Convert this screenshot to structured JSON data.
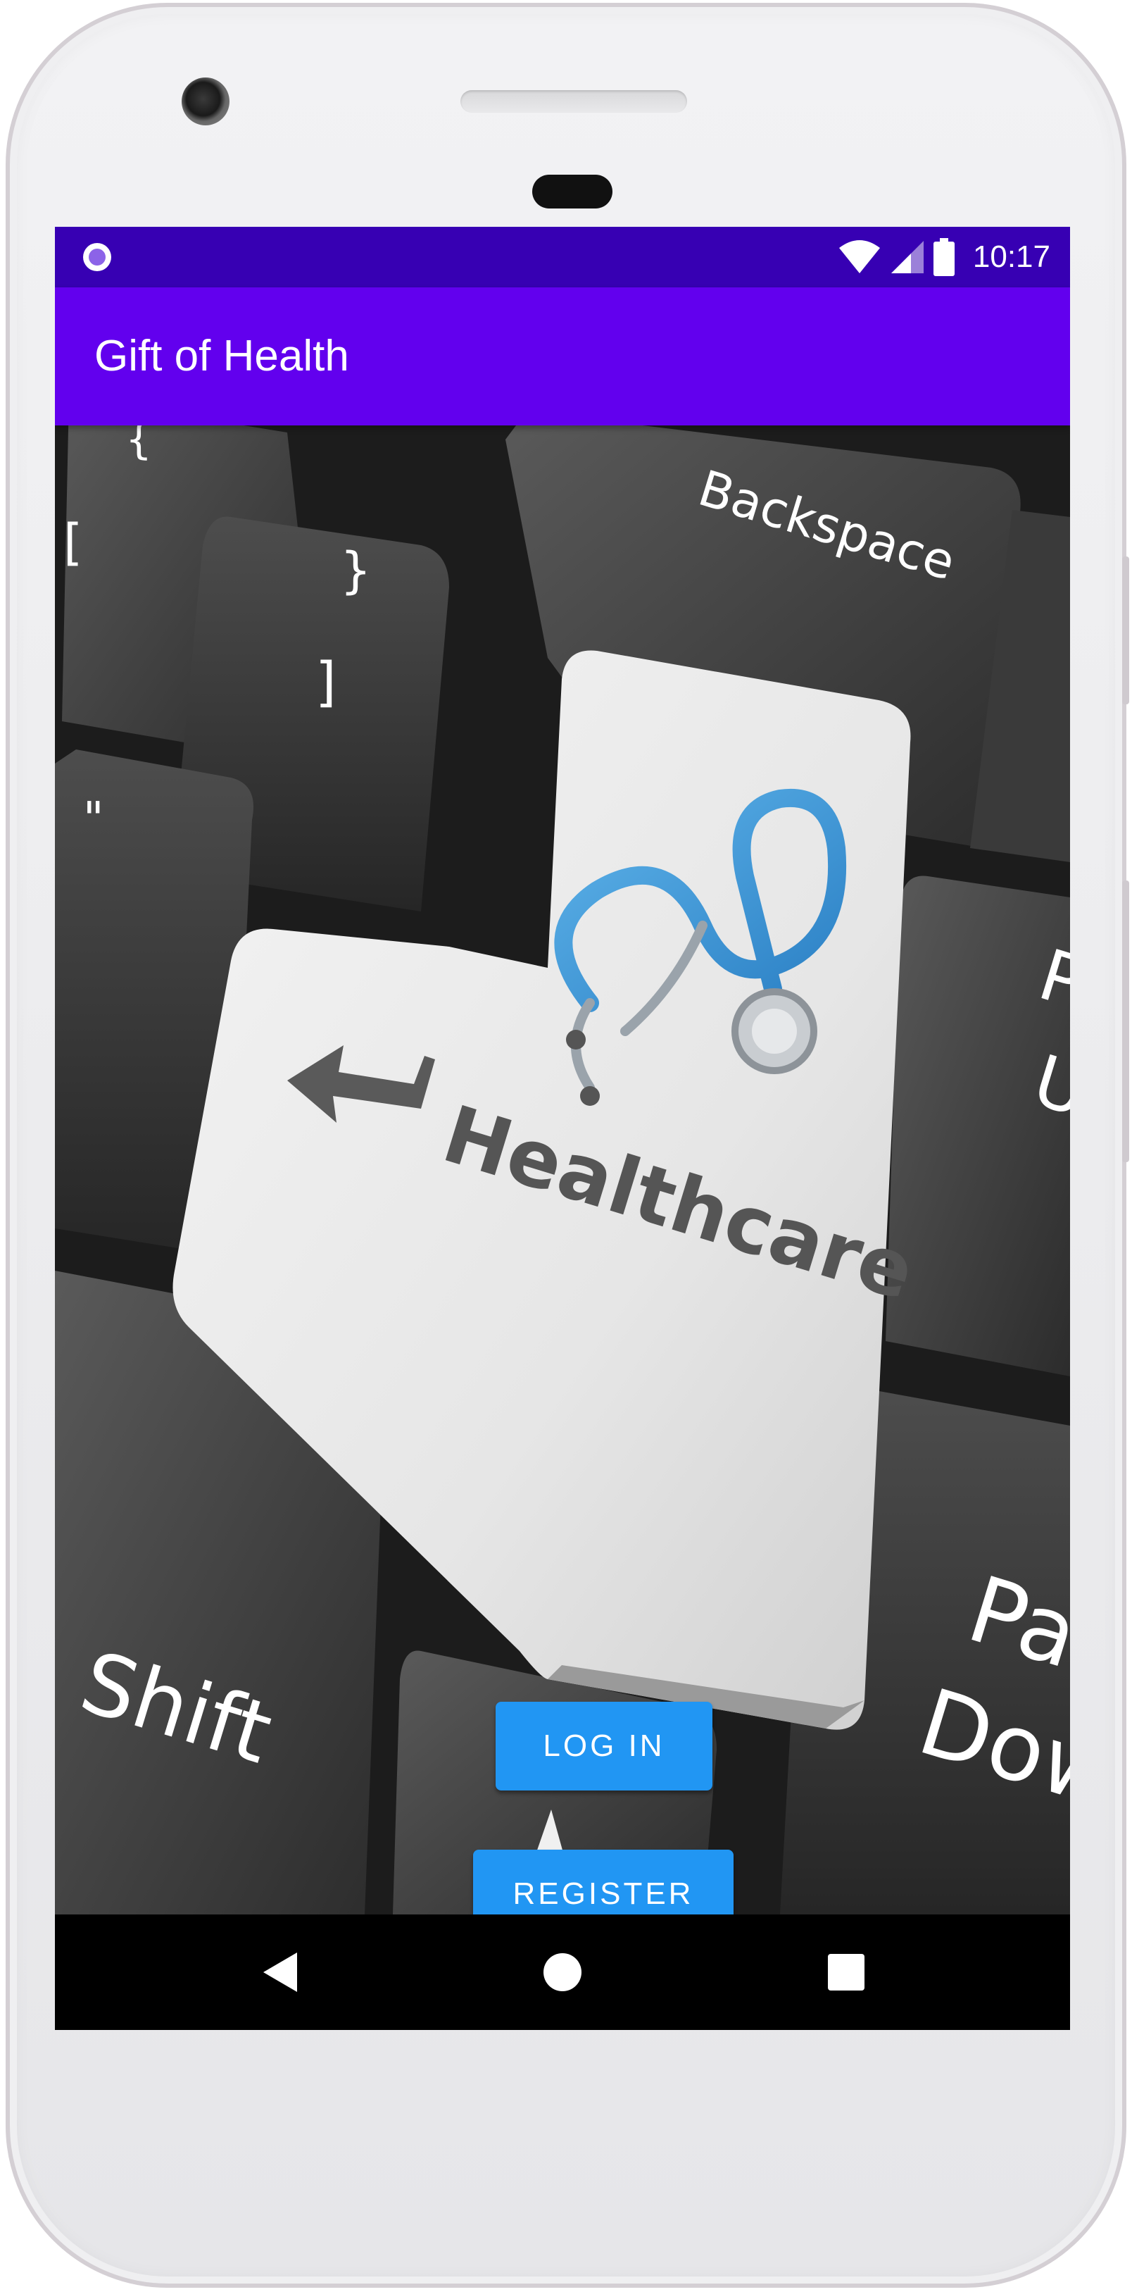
{
  "status_bar": {
    "time": "10:17",
    "background": "#3700b3",
    "icons": [
      "notification-dot-icon",
      "wifi-icon",
      "cellular-signal-icon",
      "battery-icon"
    ]
  },
  "app_bar": {
    "title": "Gift of Health",
    "background": "#6200ee"
  },
  "hero": {
    "key_labels": {
      "backspace": "Backspace",
      "healthcare": "Healthcare",
      "shift": "Shift",
      "page_down_1": "Pag",
      "page_down_2": "Dow",
      "brace_open": "{",
      "bracket_open": "[",
      "brace_close": "}",
      "bracket_close": "]",
      "quote": "\"",
      "page_up_1": "P",
      "page_up_2": "U"
    },
    "icons": [
      "stethoscope-icon",
      "enter-arrow-icon",
      "up-arrow-icon"
    ]
  },
  "actions": {
    "login_label": "LOG IN",
    "register_label": "REGISTER",
    "button_color": "#2196f3"
  },
  "nav_bar": {
    "icons": [
      "back-icon",
      "home-icon",
      "recents-icon"
    ]
  }
}
